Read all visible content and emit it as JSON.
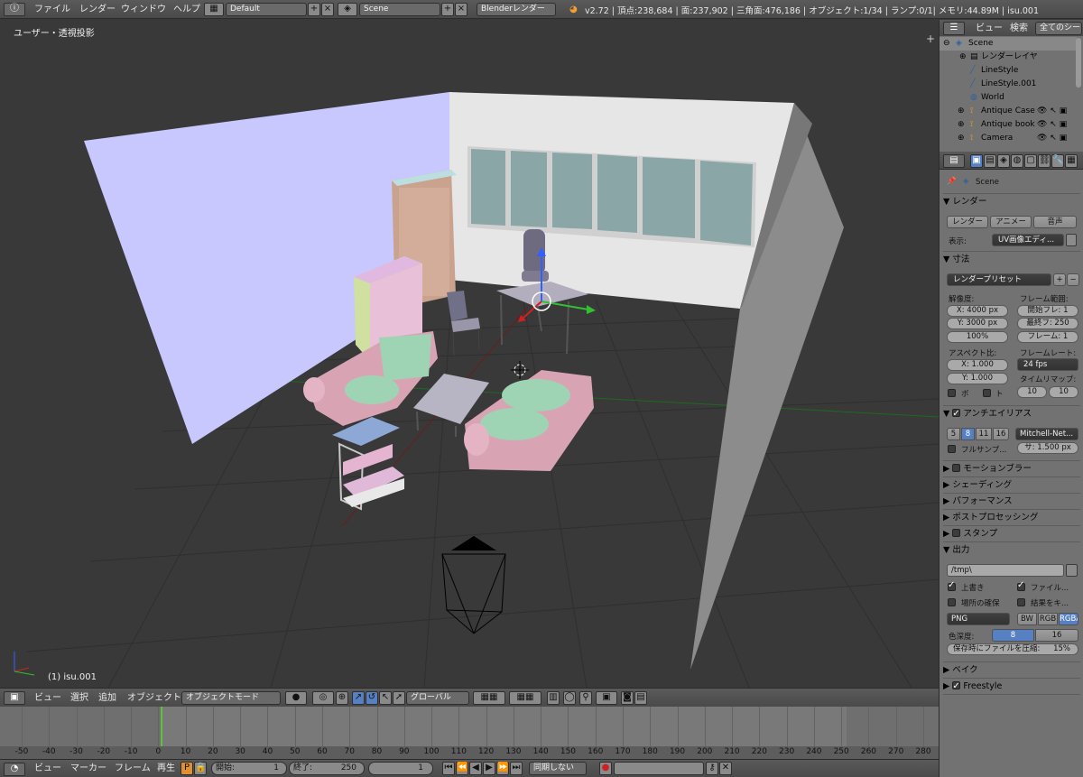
{
  "topbar": {
    "menus": [
      "ファイル",
      "レンダー",
      "ウィンドウ",
      "ヘルプ"
    ],
    "screen_layout": "Default",
    "scene": "Scene",
    "engine": "Blenderレンダー",
    "stats": "v2.72 | 頂点:238,684 | 面:237,902 | 三角面:476,186 | オブジェクト:1/34 | ランプ:0/1| メモリ:44.89M | isu.001"
  },
  "viewport": {
    "view_label": "ユーザー・透視投影",
    "object_label": "(1) isu.001"
  },
  "viewport_header": {
    "menus": [
      "ビュー",
      "選択",
      "追加",
      "オブジェクト"
    ],
    "mode": "オブジェクトモード",
    "orientation": "グローバル"
  },
  "timeline": {
    "ticks": [
      "-50",
      "-40",
      "-30",
      "-20",
      "-10",
      "0",
      "10",
      "20",
      "30",
      "40",
      "50",
      "60",
      "70",
      "80",
      "90",
      "100",
      "110",
      "120",
      "130",
      "140",
      "150",
      "160",
      "170",
      "180",
      "190",
      "200",
      "210",
      "220",
      "230",
      "240",
      "250",
      "260",
      "270",
      "280"
    ]
  },
  "timeline_header": {
    "menus": [
      "ビュー",
      "マーカー",
      "フレーム",
      "再生"
    ],
    "start_label": "開始:",
    "start_value": "1",
    "end_label": "終了:",
    "end_value": "250",
    "current_frame": "1",
    "sync": "同期しない"
  },
  "outliner": {
    "header_view": "ビュー",
    "header_search": "検索",
    "header_filter": "全てのシーン",
    "items": [
      "Scene",
      "レンダーレイヤ",
      "LineStyle",
      "LineStyle.001",
      "World",
      "Antique Case",
      "Antique booksh",
      "Camera"
    ]
  },
  "properties": {
    "scene_name": "Scene",
    "render_panel": "レンダー",
    "render_btn": "レンダー",
    "anim_btn": "アニメー",
    "audio_btn": "音声",
    "display_label": "表示:",
    "display_value": "UV画像エディ...",
    "dimensions_panel": "寸法",
    "render_preset": "レンダープリセット",
    "resolution_label": "解像度:",
    "res_x": "X:   4000 px",
    "res_y": "Y:   3000 px",
    "res_pct": "100%",
    "frame_range_label": "フレーム範囲:",
    "frame_start": "開始フレ:   1",
    "frame_end": "最終フ: 250",
    "frame_step": "フレーム:   1",
    "aspect_label": "アスペクト比:",
    "aspect_x": "X:      1.000",
    "aspect_y": "Y:      1.000",
    "framerate_label": "フレームレート:",
    "framerate": "24 fps",
    "time_remap_label": "タイムリマップ:",
    "remap_old": "10",
    "remap_new": "10",
    "border_label": "ボ",
    "crop_label": "ト",
    "aa_panel": "アンチエイリアス",
    "aa_samples": [
      "5",
      "8",
      "11",
      "16"
    ],
    "aa_filter": "Mitchell-Net...",
    "full_sample": "フルサンプ...",
    "filter_size": "サ: 1.500 px",
    "motion_blur": "モーションブラー",
    "shading": "シェーディング",
    "performance": "パフォーマンス",
    "post_processing": "ポストプロセッシング",
    "stamp": "スタンプ",
    "output_panel": "出力",
    "output_path": "/tmp\\",
    "overwrite": "上書き",
    "file_ext": "ファイル...",
    "placeholders": "場所の確保",
    "cache_result": "結果をキ...",
    "file_format": "PNG",
    "color_modes": [
      "BW",
      "RGB",
      "RGBA"
    ],
    "color_depth_label": "色深度:",
    "depth_8": "8",
    "depth_16": "16",
    "compression": "保存時にファイルを圧縮:",
    "compression_value": "15%",
    "bake": "ベイク",
    "freestyle": "Freestyle"
  },
  "colors": {
    "header_bg": "#4f4f4f",
    "viewport_bg": "#393939",
    "panel_bg": "#727272",
    "accent_blue": "#5680c2",
    "frame_cursor": "#60c040"
  }
}
